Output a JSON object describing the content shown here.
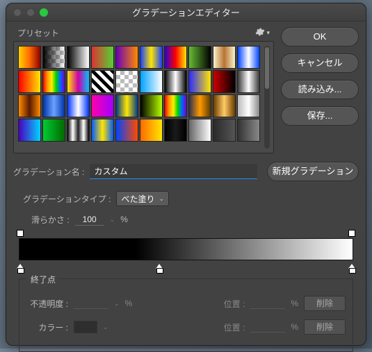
{
  "window": {
    "title": "グラデーションエディター"
  },
  "presets": {
    "label": "プリセット",
    "gear_icon": "gear"
  },
  "buttons": {
    "ok": "OK",
    "cancel": "キャンセル",
    "load": "読み込み...",
    "save": "保存...",
    "new_gradient": "新規グラデーション"
  },
  "name": {
    "label": "グラデーション名 :",
    "value": "カスタム"
  },
  "type": {
    "label": "グラデーションタイプ :",
    "value": "べた塗り"
  },
  "smoothness": {
    "label": "滑らかさ :",
    "value": "100",
    "unit": "%"
  },
  "stops_group": {
    "legend": "終了点",
    "opacity_label": "不透明度 :",
    "opacity_unit": "%",
    "color_label": "カラー :",
    "position_label": "位置 :",
    "position_unit": "%",
    "delete": "削除"
  },
  "preset_styles": [
    "linear-gradient(90deg,#ffd100,#ff6a00,#8b0000)",
    "checker-overlay:linear-gradient(90deg,rgba(0,0,0,1),rgba(0,0,0,0))",
    "linear-gradient(90deg,#000,#fff)",
    "linear-gradient(90deg,#d33,#55d133)",
    "linear-gradient(90deg,#6a00b8,#ff8a00)",
    "linear-gradient(90deg,#1840ff,#ffe600,#1840ff)",
    "linear-gradient(90deg,#2a00d6,#ff0000,#ffe600)",
    "linear-gradient(90deg,#6b3,#000)",
    "linear-gradient(90deg,#f9f2cd,#b87333,#f9f2cd)",
    "linear-gradient(90deg,#0044ff,#fff,#0044ff)",
    "linear-gradient(90deg,#ff0000,#ffe600)",
    "linear-gradient(90deg,#ff0000,#ff9900,#ffee00,#00d400,#0066ff,#7a00cc)",
    "linear-gradient(90deg,#ffe600,#cc00aa,#00c2ff)",
    "stripes",
    "checker",
    "linear-gradient(90deg,#00a2ff,#fff)",
    "linear-gradient(90deg,#000,#fff,#000)",
    "linear-gradient(90deg,#2b2bff,#ffe600)",
    "linear-gradient(90deg,#c00,#000)",
    "linear-gradient(90deg,#3a3a3a,#fff,#3a3a3a)",
    "linear-gradient(90deg,#ff8a00,#5a1a00,#ff8a00)",
    "linear-gradient(90deg,#0033aa,#6aa2ff,#0033aa)",
    "linear-gradient(90deg,#0033ff,#fff,#0033ff)",
    "linear-gradient(90deg,#ff00aa,#a000ff)",
    "linear-gradient(90deg,#003a8a,#ffe600,#003a8a)",
    "linear-gradient(90deg,#000,#b7ff00)",
    "linear-gradient(90deg,#ff0000,#ff9900,#ffee00,#00d400,#0066ff,#7a00cc)",
    "linear-gradient(90deg,#303050,#ff9a00,#5a3a00)",
    "linear-gradient(90deg,#6a3a00,#ffcc66,#6a3a00)",
    "linear-gradient(90deg,#bbb,#fff,#888)",
    "linear-gradient(90deg,#4a00c0,#00d4ff)",
    "linear-gradient(90deg,#00cc33,#006a00)",
    "linear-gradient(90deg,#000,#fff,#222,#fff,#000)",
    "linear-gradient(90deg,#005aff,#ffe600,#005aff)",
    "linear-gradient(90deg,#0044ff,#ff4a00)",
    "linear-gradient(90deg,#ff6a00,#ffe600)",
    "linear-gradient(90deg,#000,#1a1a1a,#000)",
    "linear-gradient(90deg,#666,#fff)",
    "linear-gradient(90deg,#2a2a2a,#555)",
    "linear-gradient(90deg,#333,#888)"
  ]
}
